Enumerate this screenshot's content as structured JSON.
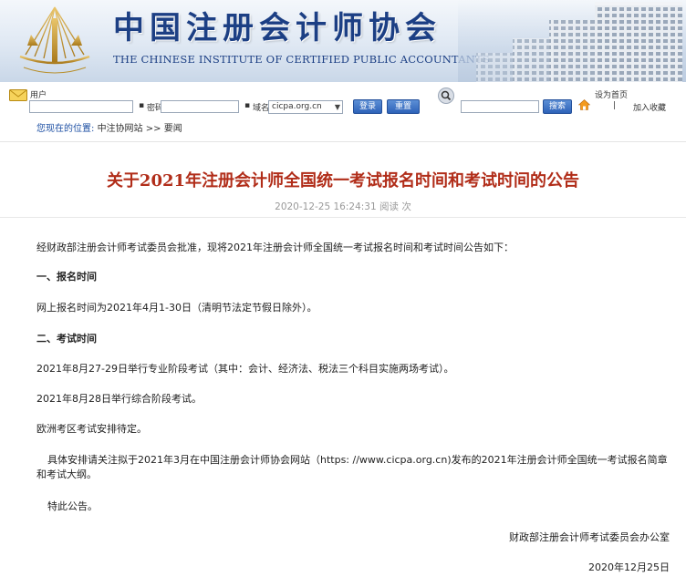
{
  "header": {
    "cn_title": "中国注册会计师协会",
    "en_title": "THE CHINESE INSTITUTE OF CERTIFIED PUBLIC ACCOUNTANTS",
    "logo_icon": "cicpa-logo-icon"
  },
  "toolbar": {
    "user_label": "用户",
    "password_label": "密码",
    "domain_label": "域名",
    "domain_value": "cicpa.org.cn",
    "login_button": "登录",
    "reset_button": "重置",
    "search_button": "搜索",
    "set_homepage": "设为首页",
    "add_favorite": "加入收藏",
    "user_value": "",
    "password_value": "",
    "search_value": ""
  },
  "breadcrumb": {
    "label": "您现在的位置:",
    "home": "中注协网站",
    "sep": ">>",
    "current": "要闻"
  },
  "article": {
    "title": "关于2021年注册会计师全国统一考试报名时间和考试时间的公告",
    "meta": "2020-12-25 16:24:31   阅读 次",
    "paragraphs": {
      "intro": "经财政部注册会计师考试委员会批准，现将2021年注册会计师全国统一考试报名时间和考试时间公告如下：",
      "h1": "一、报名时间",
      "p1": "网上报名时间为2021年4月1-30日（清明节法定节假日除外）。",
      "h2": "二、考试时间",
      "p2": "2021年8月27-29日举行专业阶段考试（其中：会计、经济法、税法三个科目实施两场考试）。",
      "p3": "2021年8月28日举行综合阶段考试。",
      "p4": "欧洲考区考试安排待定。",
      "p5": "具体安排请关注拟于2021年3月在中国注册会计师协会网站（https: //www.cicpa.org.cn)发布的2021年注册会计师全国统一考试报名简章和考试大纲。",
      "p6": "特此公告。",
      "signature": "财政部注册会计师考试委员会办公室",
      "date": "2020年12月25日"
    }
  },
  "colors": {
    "title_red": "#b12d19",
    "brand_blue": "#1c3f84",
    "button_blue": "#2d62b8"
  }
}
